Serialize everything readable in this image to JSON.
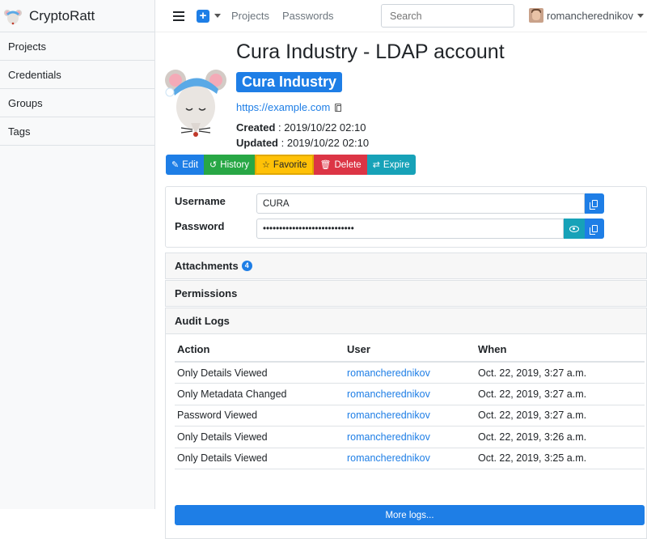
{
  "app": {
    "brand": "CryptoRatt"
  },
  "sidebar": {
    "items": [
      {
        "label": "Projects"
      },
      {
        "label": "Credentials"
      },
      {
        "label": "Groups"
      },
      {
        "label": "Tags"
      }
    ]
  },
  "navbar": {
    "projects_link": "Projects",
    "passwords_link": "Passwords",
    "search_placeholder": "Search",
    "username": "romancherednikov"
  },
  "credential": {
    "title": "Cura Industry - LDAP account",
    "project": "Cura Industry",
    "url": "https://example.com",
    "created_label": "Created",
    "created": " : 2019/10/22 02:10",
    "updated_label": "Updated",
    "updated": " : 2019/10/22 02:10",
    "username_label": "Username",
    "username_value": "CURA",
    "password_label": "Password",
    "password_value": "••••••••••••••••••••••••••••"
  },
  "actions": {
    "edit": "Edit",
    "history": "History",
    "favorite": "Favorite",
    "delete": "Delete",
    "expire": "Expire"
  },
  "sections": {
    "attachments": "Attachments",
    "attachments_count": "4",
    "permissions": "Permissions",
    "audit_logs": "Audit Logs"
  },
  "audit": {
    "headers": [
      "Action",
      "User",
      "When"
    ],
    "rows": [
      {
        "action": "Only Details Viewed",
        "user": "romancherednikov",
        "when": "Oct. 22, 2019, 3:27 a.m."
      },
      {
        "action": "Only Metadata Changed",
        "user": "romancherednikov",
        "when": "Oct. 22, 2019, 3:27 a.m."
      },
      {
        "action": "Password Viewed",
        "user": "romancherednikov",
        "when": "Oct. 22, 2019, 3:27 a.m."
      },
      {
        "action": "Only Details Viewed",
        "user": "romancherednikov",
        "when": "Oct. 22, 2019, 3:26 a.m."
      },
      {
        "action": "Only Details Viewed",
        "user": "romancherednikov",
        "when": "Oct. 22, 2019, 3:25 a.m."
      }
    ],
    "more_label": "More logs..."
  },
  "colors": {
    "primary": "#1e7ee6",
    "success": "#28a745",
    "warning": "#ffc107",
    "danger": "#dc3545",
    "info": "#17a2b8"
  },
  "icons": [
    "rat-logo-icon",
    "hamburger-icon",
    "plus-icon",
    "chevron-down-icon",
    "copy-icon",
    "edit-icon",
    "history-icon",
    "star-icon",
    "trash-icon",
    "exchange-icon",
    "eye-icon"
  ]
}
